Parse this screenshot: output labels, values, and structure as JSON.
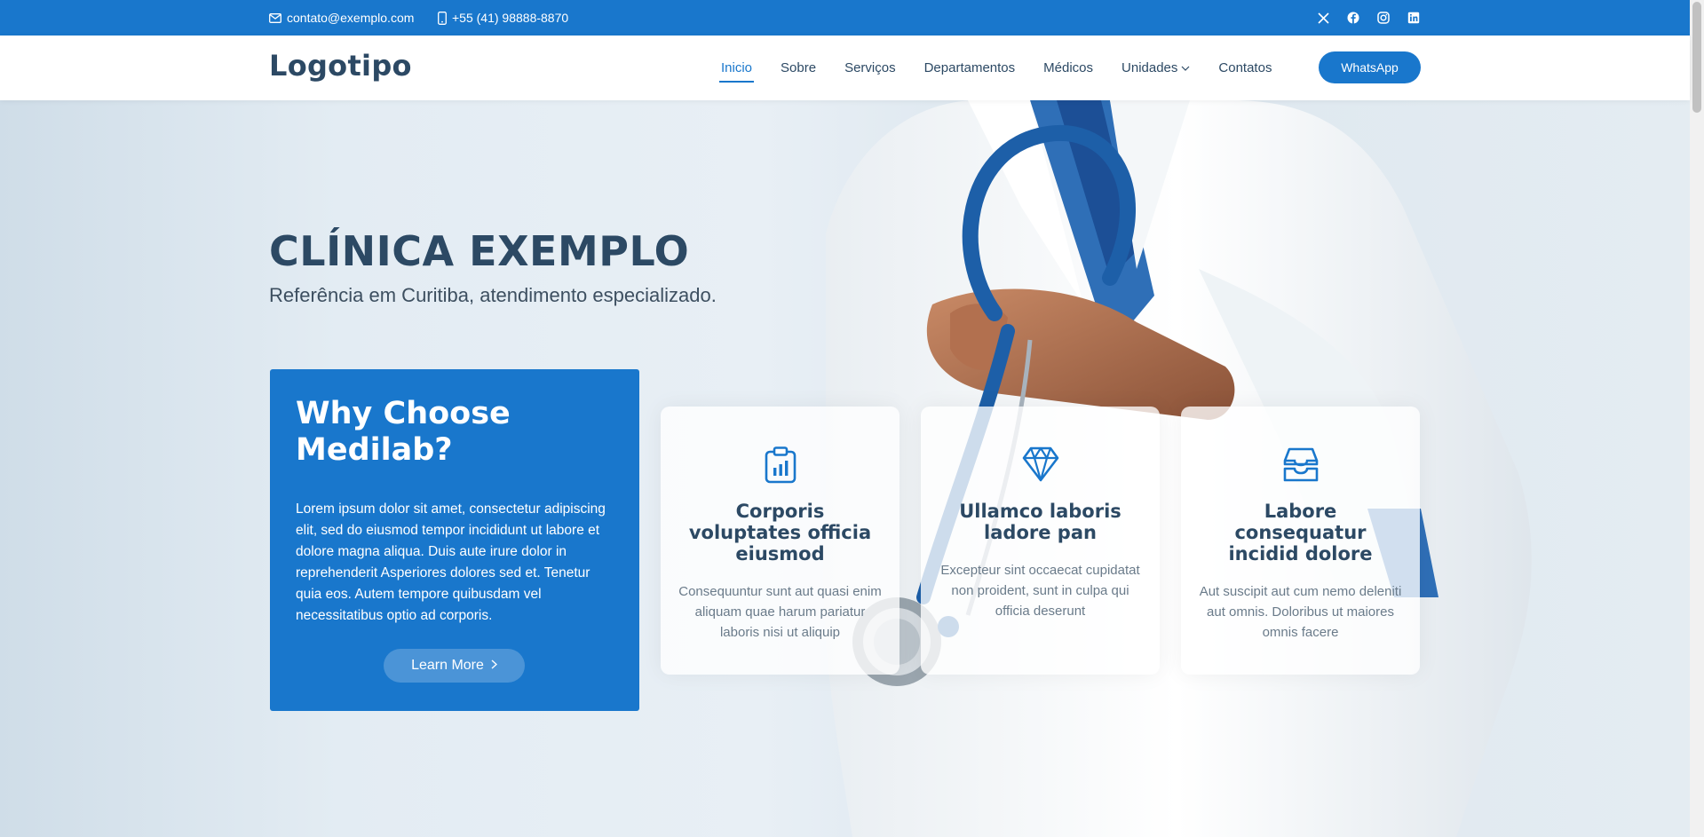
{
  "topbar": {
    "email": "contato@exemplo.com",
    "phone": "+55 (41) 98888-8870",
    "socials": [
      "x-icon",
      "facebook-icon",
      "instagram-icon",
      "linkedin-icon"
    ]
  },
  "header": {
    "logo": "Logotipo",
    "nav": {
      "inicio": "Inicio",
      "sobre": "Sobre",
      "servicos": "Serviços",
      "departamentos": "Departamentos",
      "medicos": "Médicos",
      "unidades": "Unidades",
      "contatos": "Contatos"
    },
    "whatsapp": "WhatsApp"
  },
  "hero": {
    "title": "CLÍNICA EXEMPLO",
    "subtitle": "Referência em Curitiba, atendimento especializado."
  },
  "why": {
    "title": "Why Choose Medilab?",
    "text": "Lorem ipsum dolor sit amet, consectetur adipiscing elit, sed do eiusmod tempor incididunt ut labore et dolore magna aliqua. Duis aute irure dolor in reprehenderit Asperiores dolores sed et. Tenetur quia eos. Autem tempore quibusdam vel necessitatibus optio ad corporis.",
    "button": "Learn More"
  },
  "cards": [
    {
      "icon": "clipboard-data-icon",
      "title": "Corporis voluptates officia eiusmod",
      "text": "Consequuntur sunt aut quasi enim aliquam quae harum pariatur laboris nisi ut aliquip"
    },
    {
      "icon": "gem-icon",
      "title": "Ullamco laboris ladore pan",
      "text": "Excepteur sint occaecat cupidatat non proident, sunt in culpa qui officia deserunt"
    },
    {
      "icon": "inboxes-icon",
      "title": "Labore consequatur incidid dolore",
      "text": "Aut suscipit aut cum nemo deleniti aut omnis. Doloribus ut maiores omnis facere"
    }
  ],
  "colors": {
    "accent": "#1977cc",
    "heading": "#2c4964"
  }
}
